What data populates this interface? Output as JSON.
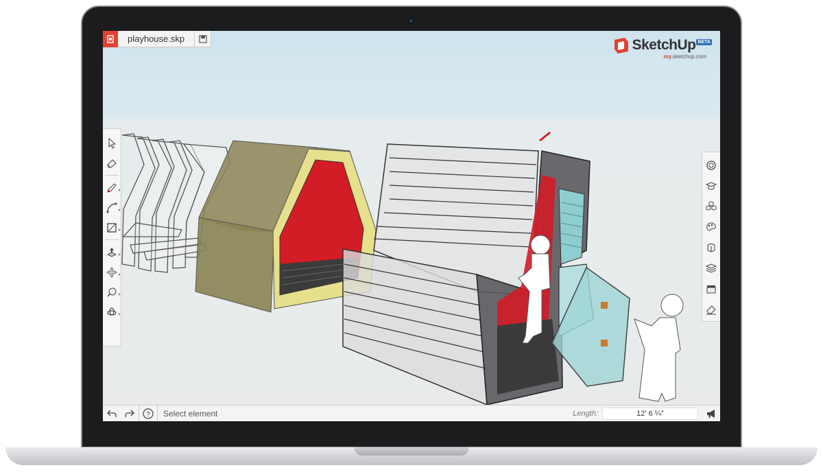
{
  "file": {
    "name": "playhouse.skp"
  },
  "logo": {
    "word": "SketchUp",
    "badge": "BETA",
    "sub_prefix": "my.",
    "sub_domain": "sketchup.com"
  },
  "status": {
    "message": "Select element",
    "length_label": "Length:",
    "length_value": "12' 6 ¼\""
  },
  "left_toolbar": [
    "select-tool",
    "eraser-tool",
    "pencil-tool",
    "arc-tool",
    "rectangle-tool",
    "push-pull-tool",
    "move-tool",
    "tape-measure-tool",
    "orbit-tool"
  ],
  "right_toolbar": [
    "instructor-panel",
    "model-info-panel",
    "components-panel",
    "materials-panel",
    "entity-info-panel",
    "layers-panel",
    "scenes-panel",
    "outliner-panel"
  ],
  "colors": {
    "brand_red": "#e24230",
    "wall_olive": "#8c8455",
    "trim_yellow": "#e6e08c",
    "interior_red": "#d21c26",
    "glass_teal": "#8ecdd0"
  }
}
